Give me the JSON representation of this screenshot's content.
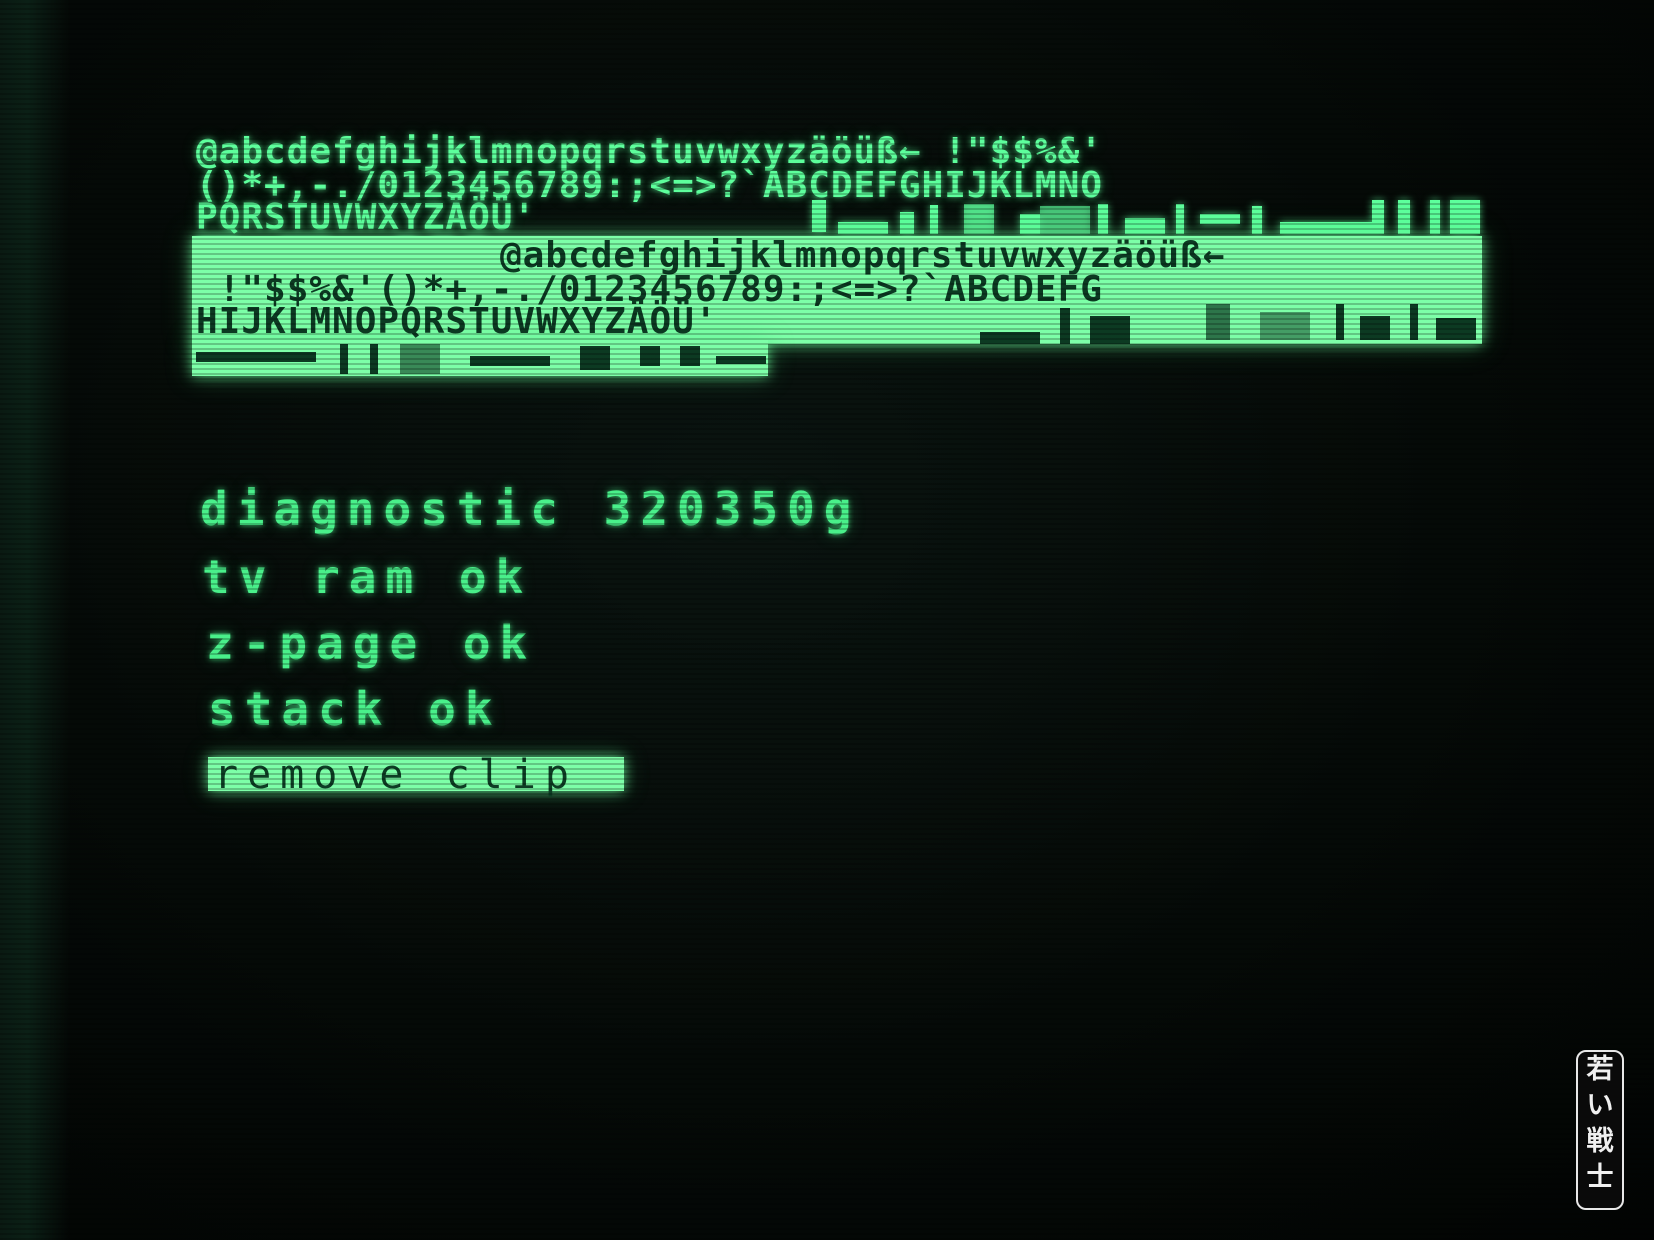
{
  "charset": {
    "normal_line_1": "@abcdefghijklmnopqrstuvwxyzäöüß← !\"$$%&'",
    "normal_line_2": "()*+,-./0123456789:;<=>?`ABCDEFGHIJKLMNO",
    "normal_line_3": "PQRSTUVWXYZÄÖÜ'",
    "inverse_line_1": "@abcdefghijklmnopqrstuvwxyzäöüß←",
    "inverse_line_2": " !\"$$%&'()*+,-./0123456789:;<=>?`ABCDEFG",
    "inverse_line_3": "HIJKLMNOPQRSTUVWXYZÄÖÜ'"
  },
  "diagnostics": {
    "title": "diagnostic 320350g",
    "line_tv_ram": "tv ram ok",
    "line_zpage": "z-page ok",
    "line_stack": "stack ok",
    "prompt": "remove clip"
  },
  "watermark": {
    "chars": [
      "若",
      "い",
      "戦",
      "士"
    ]
  },
  "colors": {
    "phosphor": "#5dff9c",
    "phosphor_bright": "#7dffa8",
    "inverse_text": "#0c3a22",
    "background": "#040806"
  }
}
